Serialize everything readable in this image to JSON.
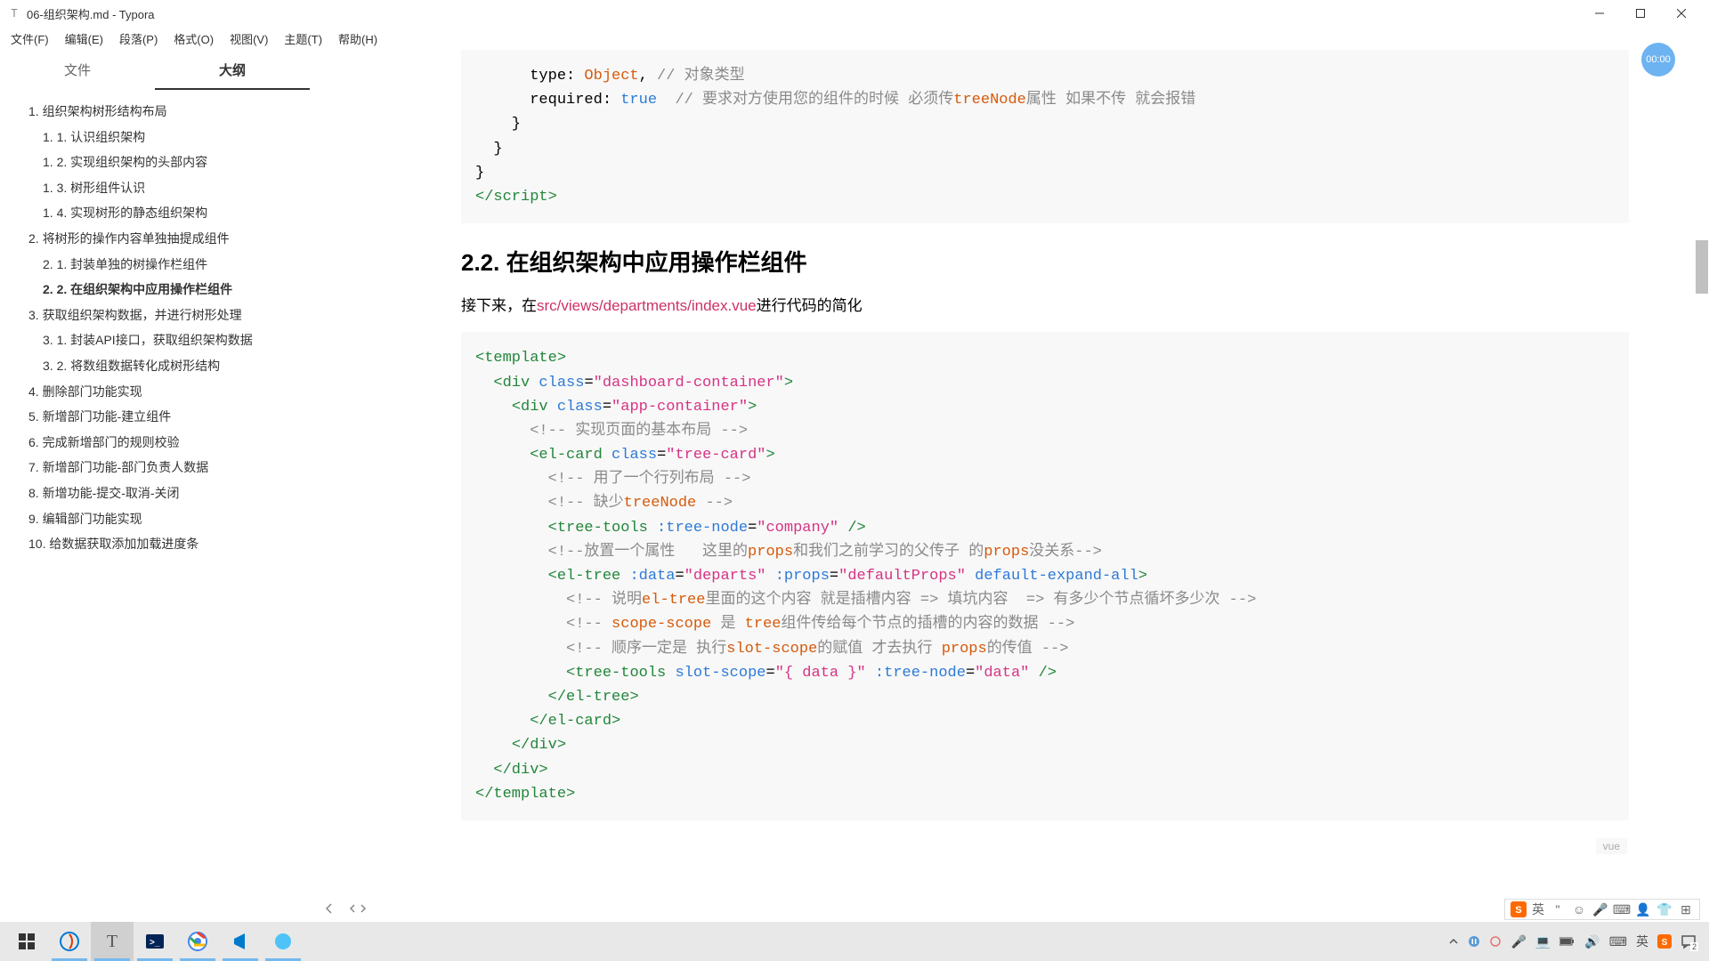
{
  "window": {
    "title": "06-组织架构.md - Typora"
  },
  "menu": {
    "file": "文件(F)",
    "edit": "编辑(E)",
    "paragraph": "段落(P)",
    "format": "格式(O)",
    "view": "视图(V)",
    "theme": "主题(T)",
    "help": "帮助(H)"
  },
  "sidebar": {
    "tab_files": "文件",
    "tab_outline": "大纲",
    "outline": [
      {
        "lvl": 1,
        "num": "1.",
        "text": "组织架构树形结构布局",
        "active": false
      },
      {
        "lvl": 2,
        "num": "1. 1.",
        "text": "认识组织架构",
        "active": false
      },
      {
        "lvl": 2,
        "num": "1. 2.",
        "text": "实现组织架构的头部内容",
        "active": false
      },
      {
        "lvl": 2,
        "num": "1. 3.",
        "text": "树形组件认识",
        "active": false
      },
      {
        "lvl": 2,
        "num": "1. 4.",
        "text": "实现树形的静态组织架构",
        "active": false
      },
      {
        "lvl": 1,
        "num": "2.",
        "text": "将树形的操作内容单独抽提成组件",
        "active": false
      },
      {
        "lvl": 2,
        "num": "2. 1.",
        "text": "封装单独的树操作栏组件",
        "active": false
      },
      {
        "lvl": 2,
        "num": "2. 2.",
        "text": "在组织架构中应用操作栏组件",
        "active": true
      },
      {
        "lvl": 1,
        "num": "3.",
        "text": "获取组织架构数据，并进行树形处理",
        "active": false
      },
      {
        "lvl": 2,
        "num": "3. 1.",
        "text": "封装API接口，获取组织架构数据",
        "active": false
      },
      {
        "lvl": 2,
        "num": "3. 2.",
        "text": "将数组数据转化成树形结构",
        "active": false
      },
      {
        "lvl": 1,
        "num": "4.",
        "text": "删除部门功能实现",
        "active": false
      },
      {
        "lvl": 1,
        "num": "5.",
        "text": "新增部门功能-建立组件",
        "active": false
      },
      {
        "lvl": 1,
        "num": "6.",
        "text": "完成新增部门的规则校验",
        "active": false
      },
      {
        "lvl": 1,
        "num": "7.",
        "text": "新增部门功能-部门负责人数据",
        "active": false
      },
      {
        "lvl": 1,
        "num": "8.",
        "text": "新增功能-提交-取消-关闭",
        "active": false
      },
      {
        "lvl": 1,
        "num": "9.",
        "text": "编辑部门功能实现",
        "active": false
      },
      {
        "lvl": 1,
        "num": "10.",
        "text": "给数据获取添加加载进度条",
        "active": false
      }
    ]
  },
  "content": {
    "heading_num": "2.2.",
    "heading_text": "在组织架构中应用操作栏组件",
    "para_prefix": "接下来，在",
    "para_code": "src/views/departments/index.vue",
    "para_suffix": "进行代码的简化",
    "code1": {
      "l1_indent": "      type: ",
      "l1_val": "Object",
      "l1_cmt": "// 对象类型",
      "l2_indent": "      required: ",
      "l2_val": "true",
      "l2_cmt": "// 要求对方使用您的组件的时候 必须传",
      "l2_kw": "treeNode",
      "l2_cmt2": "属性 如果不传 就会报错",
      "l3": "    }",
      "l4": "  }",
      "l5": "}",
      "l6a": "</",
      "l6b": "script",
      "l6c": ">"
    },
    "code2": {
      "lang": "vue"
    }
  },
  "timer": "00:00",
  "ime": {
    "mode": "英"
  },
  "tray": {
    "notif_count": "2"
  }
}
